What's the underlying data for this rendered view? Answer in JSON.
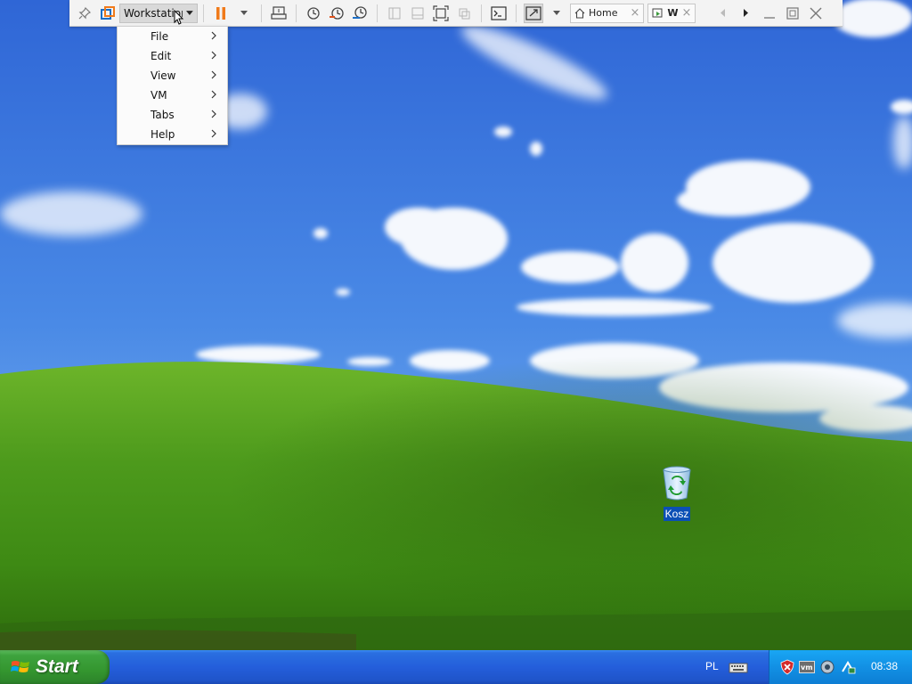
{
  "toolbar": {
    "menu_label": "Workstation",
    "tabs": [
      {
        "label": "Home"
      },
      {
        "label": "W"
      }
    ]
  },
  "menu": {
    "items": [
      {
        "label": "File"
      },
      {
        "label": "Edit"
      },
      {
        "label": "View"
      },
      {
        "label": "VM"
      },
      {
        "label": "Tabs"
      },
      {
        "label": "Help"
      }
    ]
  },
  "desktop": {
    "icons": [
      {
        "label": "Kosz",
        "icon": "recycle-bin-icon"
      }
    ]
  },
  "taskbar": {
    "start_label": "Start",
    "language": "PL",
    "clock": "08:38"
  },
  "colors": {
    "taskbar_blue": "#245edb",
    "start_green": "#3ea33e",
    "tray_blue": "#1290e4",
    "pause_orange": "#f07a1a"
  }
}
